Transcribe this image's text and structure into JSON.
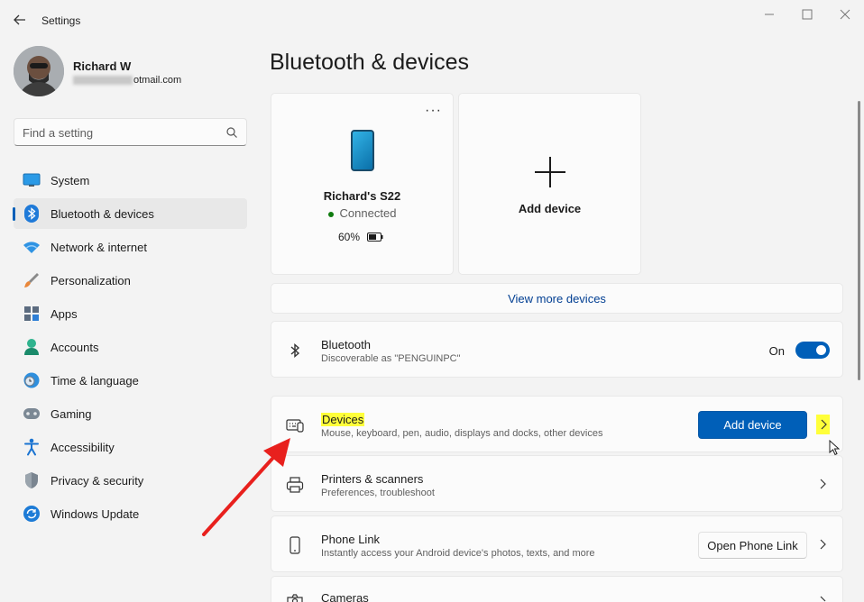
{
  "window": {
    "title": "Settings"
  },
  "profile": {
    "name": "Richard W",
    "email_visible": "otmail.com"
  },
  "search": {
    "placeholder": "Find a setting"
  },
  "nav": {
    "items": [
      {
        "label": "System",
        "icon": "monitor-icon"
      },
      {
        "label": "Bluetooth & devices",
        "icon": "bluetooth-icon",
        "active": true
      },
      {
        "label": "Network & internet",
        "icon": "wifi-icon"
      },
      {
        "label": "Personalization",
        "icon": "brush-icon"
      },
      {
        "label": "Apps",
        "icon": "apps-icon"
      },
      {
        "label": "Accounts",
        "icon": "person-icon"
      },
      {
        "label": "Time & language",
        "icon": "globe-clock-icon"
      },
      {
        "label": "Gaming",
        "icon": "gamepad-icon"
      },
      {
        "label": "Accessibility",
        "icon": "accessibility-icon"
      },
      {
        "label": "Privacy & security",
        "icon": "shield-icon"
      },
      {
        "label": "Windows Update",
        "icon": "update-icon"
      }
    ]
  },
  "main": {
    "title": "Bluetooth & devices",
    "device_card": {
      "name": "Richard's S22",
      "status": "Connected",
      "battery": "60%",
      "more": "···"
    },
    "add_card": {
      "label": "Add device"
    },
    "view_more": "View more devices",
    "bluetooth": {
      "title": "Bluetooth",
      "subtitle": "Discoverable as \"PENGUINPC\"",
      "toggle_label": "On",
      "toggle_on": true
    },
    "devices_row": {
      "title": "Devices",
      "subtitle": "Mouse, keyboard, pen, audio, displays and docks, other devices",
      "button": "Add device"
    },
    "printers_row": {
      "title": "Printers & scanners",
      "subtitle": "Preferences, troubleshoot"
    },
    "phone_link_row": {
      "title": "Phone Link",
      "subtitle": "Instantly access your Android device's photos, texts, and more",
      "button": "Open Phone Link"
    },
    "cameras_row": {
      "title": "Cameras"
    }
  },
  "colors": {
    "accent": "#005fb8",
    "highlight": "#ffff3a",
    "arrow": "#e8201d"
  }
}
